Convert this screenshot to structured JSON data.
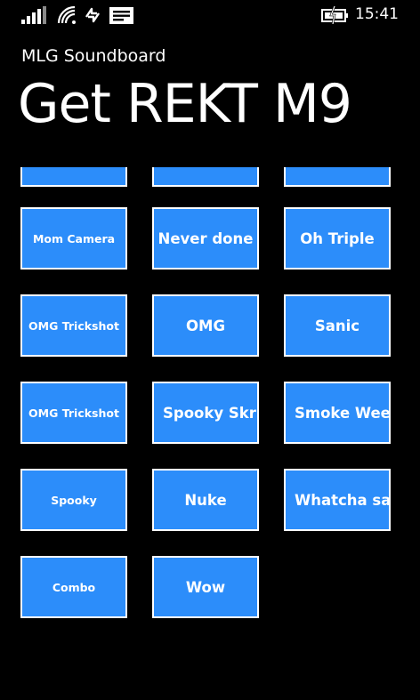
{
  "status_bar": {
    "time": "15:41",
    "icons": [
      "signal-strength-icon",
      "wifi-icon",
      "data-sync-icon",
      "message-icon",
      "battery-charging-icon"
    ]
  },
  "header": {
    "app_name": "MLG Soundboard",
    "page_title": "Get REKT M9"
  },
  "tiles": [
    {
      "label": ""
    },
    {
      "label": ""
    },
    {
      "label": ""
    },
    {
      "label": "Mom Camera"
    },
    {
      "label": "Never done"
    },
    {
      "label": "Oh Triple"
    },
    {
      "label": "OMG Trickshot"
    },
    {
      "label": "OMG"
    },
    {
      "label": "Sanic"
    },
    {
      "label": "OMG Trickshot"
    },
    {
      "label": "Spooky Skril"
    },
    {
      "label": "Smoke Weed"
    },
    {
      "label": "Spooky"
    },
    {
      "label": "Nuke"
    },
    {
      "label": "Whatcha say"
    },
    {
      "label": "Combo"
    },
    {
      "label": "Wow"
    }
  ],
  "colors": {
    "background": "#000000",
    "tile_fill": "#2c8dfa",
    "tile_border": "#ffffff",
    "text": "#ffffff"
  }
}
